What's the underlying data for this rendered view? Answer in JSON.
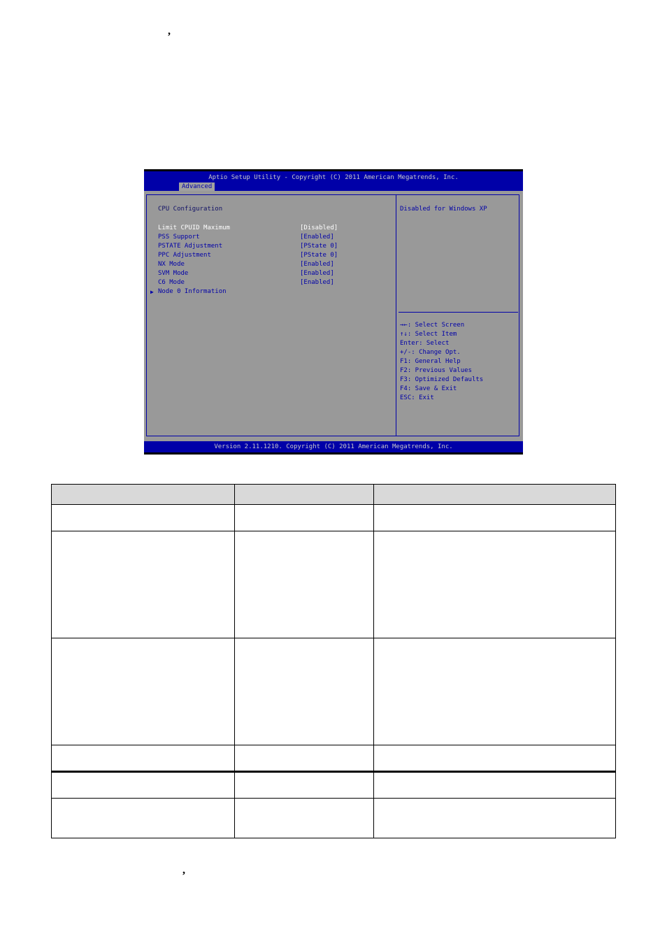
{
  "page": {
    "top_punctuation": ",",
    "bottom_punctuation": ","
  },
  "bios": {
    "title": "Aptio Setup Utility - Copyright (C) 2011 American Megatrends, Inc.",
    "active_tab": "Advanced",
    "section_title": "CPU Configuration",
    "items": [
      {
        "label": "Limit CPUID Maximum",
        "value": "[Disabled]",
        "selected": true,
        "submenu": false
      },
      {
        "label": "PSS Support",
        "value": "[Enabled]",
        "selected": false,
        "submenu": false
      },
      {
        "label": "PSTATE Adjustment",
        "value": "[PState 0]",
        "selected": false,
        "submenu": false
      },
      {
        "label": "PPC Adjustment",
        "value": "[PState 0]",
        "selected": false,
        "submenu": false
      },
      {
        "label": "NX Mode",
        "value": "[Enabled]",
        "selected": false,
        "submenu": false
      },
      {
        "label": "SVM Mode",
        "value": "[Enabled]",
        "selected": false,
        "submenu": false
      },
      {
        "label": "C6 Mode",
        "value": "[Enabled]",
        "selected": false,
        "submenu": false
      },
      {
        "label": "Node 0 Information",
        "value": "",
        "selected": false,
        "submenu": true
      }
    ],
    "submenu_arrow_icon": "▶",
    "help_text": "Disabled for Windows XP",
    "key_help": [
      "→←: Select Screen",
      "↑↓: Select Item",
      "Enter: Select",
      "+/-: Change Opt.",
      "F1: General Help",
      "F2: Previous Values",
      "F3: Optimized Defaults",
      "F4: Save & Exit",
      "ESC: Exit"
    ],
    "footer": "Version 2.11.1210. Copyright (C) 2011 American Megatrends, Inc.",
    "colors": {
      "header_blue": "#0000a8",
      "body_gray": "#999999",
      "selected_text": "#ffffff",
      "item_text": "#0000a8"
    }
  },
  "table": {
    "headers": [
      "",
      "",
      ""
    ],
    "rows": [
      [
        "",
        "",
        ""
      ],
      [
        "",
        "",
        ""
      ],
      [
        "",
        "",
        ""
      ],
      [
        "",
        "",
        ""
      ],
      [
        "",
        "",
        ""
      ],
      [
        "",
        "",
        ""
      ]
    ]
  }
}
